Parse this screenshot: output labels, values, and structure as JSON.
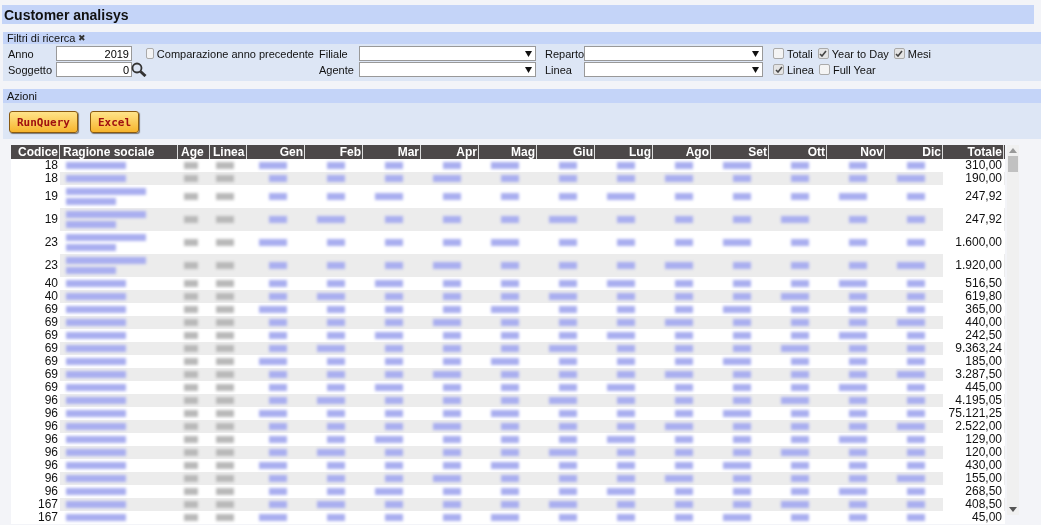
{
  "window": {
    "title": "Customer analisys"
  },
  "filters": {
    "title": "Filtri di ricerca",
    "collapse_icon": "✖",
    "anno": {
      "label": "Anno",
      "value": "2019"
    },
    "soggetto": {
      "label": "Soggetto",
      "value": "0"
    },
    "comparazione": {
      "label": "Comparazione anno precedente",
      "checked": false
    },
    "selects": [
      {
        "label": "Filiale"
      },
      {
        "label": "Agente"
      },
      {
        "label": "Reparto"
      },
      {
        "label": "Linea"
      }
    ],
    "options_row1": [
      {
        "label": "Totali",
        "checked": false
      },
      {
        "label": "Year to Day",
        "checked": true
      },
      {
        "label": "Mesi",
        "checked": true
      }
    ],
    "options_row2": [
      {
        "label": "Linea",
        "checked": true
      },
      {
        "label": "Full Year",
        "checked": false
      }
    ]
  },
  "actions": {
    "title": "Azioni",
    "buttons": [
      "RunQuery",
      "Excel"
    ]
  },
  "table": {
    "columns": [
      "Codice",
      "Ragione sociale",
      "Age",
      "Linea",
      "Gen",
      "Feb",
      "Mar",
      "Apr",
      "Mag",
      "Giu",
      "Lug",
      "Ago",
      "Set",
      "Ott",
      "Nov",
      "Dic",
      "Totale"
    ],
    "rows": [
      {
        "codice": "18",
        "totale": "310,00",
        "wrapped": false
      },
      {
        "codice": "18",
        "totale": "190,00",
        "wrapped": false
      },
      {
        "codice": "19",
        "totale": "247,92",
        "wrapped": true
      },
      {
        "codice": "19",
        "totale": "247,92",
        "wrapped": true
      },
      {
        "codice": "23",
        "totale": "1.600,00",
        "wrapped": true
      },
      {
        "codice": "23",
        "totale": "1.920,00",
        "wrapped": true
      },
      {
        "codice": "40",
        "totale": "516,50",
        "wrapped": false
      },
      {
        "codice": "40",
        "totale": "619,80",
        "wrapped": false
      },
      {
        "codice": "69",
        "totale": "365,00",
        "wrapped": false
      },
      {
        "codice": "69",
        "totale": "440,00",
        "wrapped": false
      },
      {
        "codice": "69",
        "totale": "242,50",
        "wrapped": false
      },
      {
        "codice": "69",
        "totale": "9.363,24",
        "wrapped": false
      },
      {
        "codice": "69",
        "totale": "185,00",
        "wrapped": false
      },
      {
        "codice": "69",
        "totale": "3.287,50",
        "wrapped": false
      },
      {
        "codice": "69",
        "totale": "445,00",
        "wrapped": false
      },
      {
        "codice": "96",
        "totale": "4.195,05",
        "wrapped": false
      },
      {
        "codice": "96",
        "totale": "75.121,25",
        "wrapped": false
      },
      {
        "codice": "96",
        "totale": "2.522,00",
        "wrapped": false
      },
      {
        "codice": "96",
        "totale": "129,00",
        "wrapped": false
      },
      {
        "codice": "96",
        "totale": "120,00",
        "wrapped": false
      },
      {
        "codice": "96",
        "totale": "430,00",
        "wrapped": false
      },
      {
        "codice": "96",
        "totale": "155,00",
        "wrapped": false
      },
      {
        "codice": "96",
        "totale": "268,50",
        "wrapped": false
      },
      {
        "codice": "167",
        "totale": "408,50",
        "wrapped": false
      },
      {
        "codice": "167",
        "totale": "45,00",
        "wrapped": false
      }
    ]
  }
}
